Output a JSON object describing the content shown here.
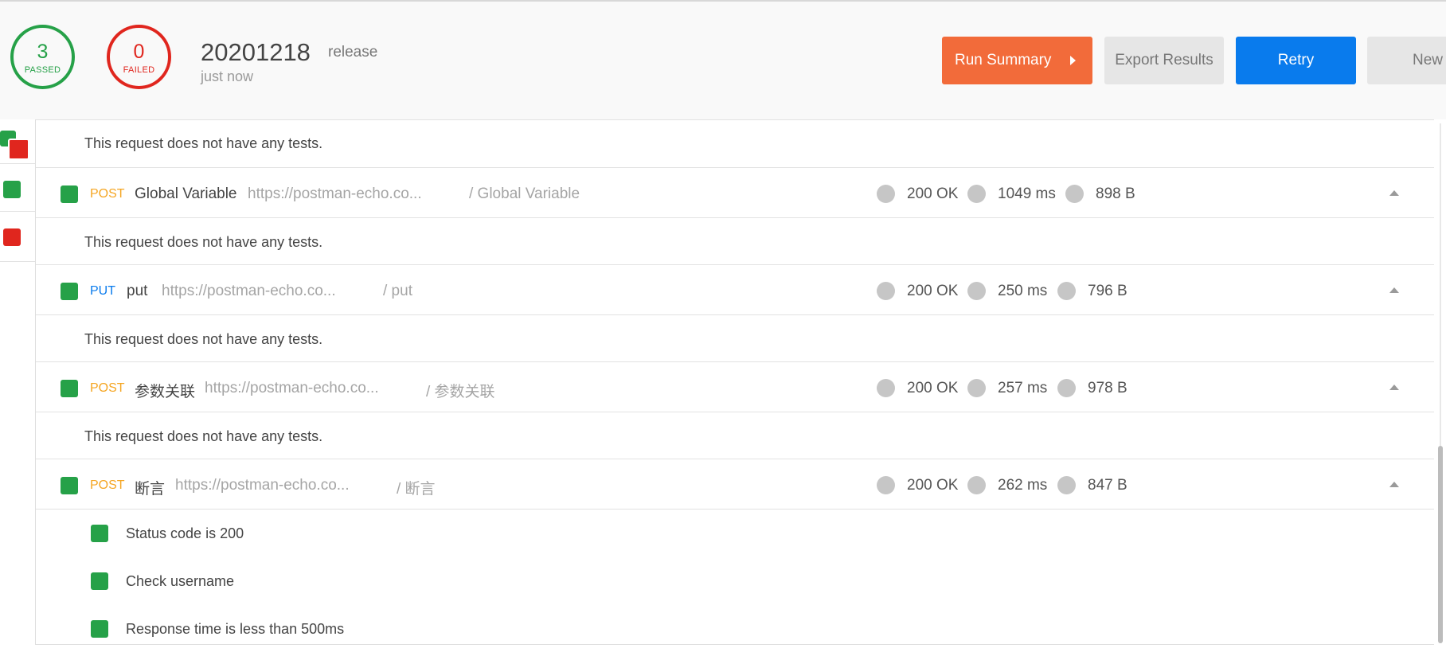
{
  "summary": {
    "passed_count": "3",
    "passed_label": "PASSED",
    "failed_count": "0",
    "failed_label": "FAILED",
    "run_name": "20201218",
    "environment": "release",
    "timestamp": "just now"
  },
  "toolbar": {
    "run_summary": "Run Summary",
    "export_results": "Export Results",
    "retry": "Retry",
    "new": "New"
  },
  "no_tests_text": "This request does not have any tests.",
  "requests": [
    {
      "method": "POST",
      "name": "Global Variable",
      "url": "https://postman-echo.co...",
      "path": "/ Global Variable",
      "status": "200 OK",
      "time": "1049 ms",
      "size": "898 B"
    },
    {
      "method": "PUT",
      "name": "put",
      "url": "https://postman-echo.co...",
      "path": "/ put",
      "status": "200 OK",
      "time": "250 ms",
      "size": "796 B"
    },
    {
      "method": "POST",
      "name": "参数关联",
      "url": "https://postman-echo.co...",
      "path": "/ 参数关联",
      "status": "200 OK",
      "time": "257 ms",
      "size": "978 B"
    },
    {
      "method": "POST",
      "name": "断言",
      "url": "https://postman-echo.co...",
      "path": "/ 断言",
      "status": "200 OK",
      "time": "262 ms",
      "size": "847 B"
    }
  ],
  "tests": [
    "Status code is 200",
    "Check username",
    "Response time is less than 500ms"
  ],
  "colors": {
    "pass": "#26a148",
    "fail": "#e0261e",
    "post": "#f5a623",
    "put": "#097bed",
    "run_summary": "#f26b3a",
    "retry": "#097bed"
  }
}
